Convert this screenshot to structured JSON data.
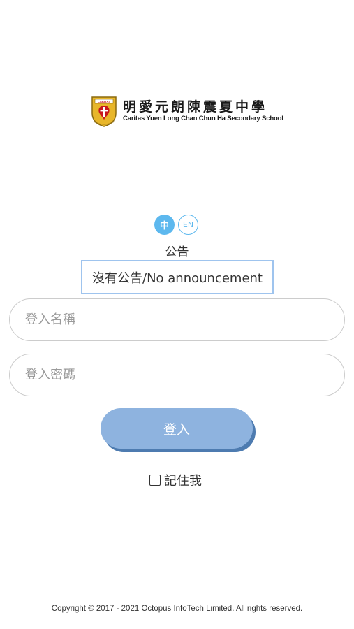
{
  "logo": {
    "name_cn": "明愛元朗陳震夏中學",
    "name_en": "Caritas Yuen Long Chan Chun Ha Secondary School",
    "crest_text": "CARITAS",
    "crest_colors": {
      "gold": "#e8b62a",
      "red": "#c8161d",
      "outline": "#8a6a10"
    }
  },
  "language": {
    "zh_label": "中",
    "en_label": "EN",
    "selected": "zh"
  },
  "announcement": {
    "title": "公告",
    "text": "沒有公告/No announcement"
  },
  "form": {
    "username_placeholder": "登入名稱",
    "username_value": "",
    "password_placeholder": "登入密碼",
    "password_value": "",
    "login_label": "登入",
    "remember_label": "記住我",
    "remember_checked": false
  },
  "footer": {
    "copyright": "Copyright © 2017 - 2021 Octopus InfoTech Limited. All rights reserved."
  },
  "colors": {
    "accent": "#5db8ee",
    "button_bg": "#8eb3df",
    "button_shadow": "#4d7bb0",
    "announcement_border": "#9fc4ee",
    "field_border": "#cccccc"
  }
}
